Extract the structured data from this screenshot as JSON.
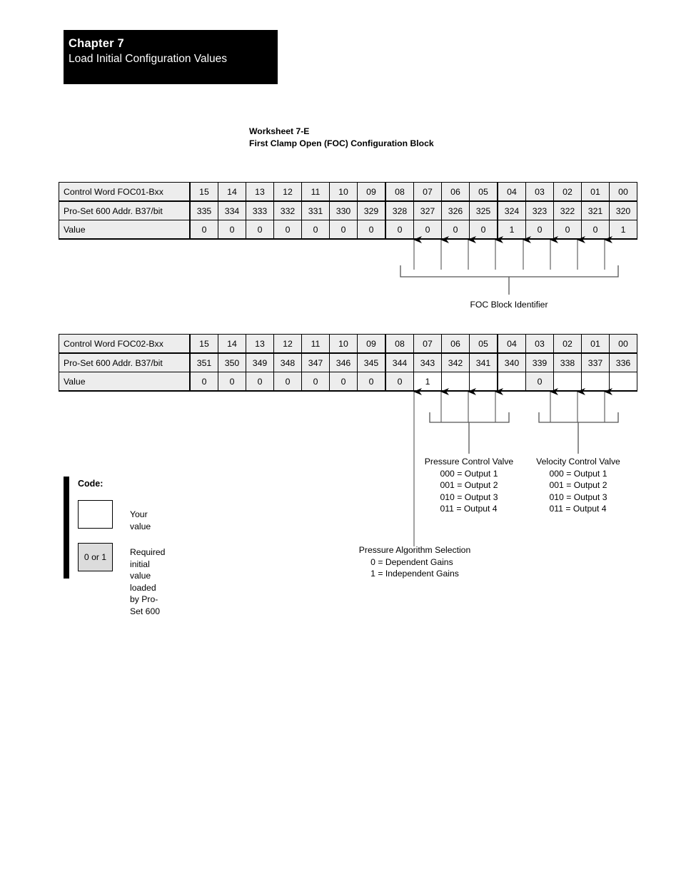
{
  "chapter": {
    "label": "Chapter  7",
    "title": "Load Initial Configuration Values"
  },
  "worksheet": {
    "number": "Worksheet 7-E",
    "name": "First Clamp Open (FOC) Configuration  Block"
  },
  "tables": [
    {
      "id": "foc01",
      "row_labels": {
        "control_word": "Control Word FOC01-Bxx",
        "address": "Pro-Set 600 Addr. B37/bit",
        "value": "Value"
      },
      "bits": [
        "15",
        "14",
        "13",
        "12",
        "11",
        "10",
        "09",
        "08",
        "07",
        "06",
        "05",
        "04",
        "03",
        "02",
        "01",
        "00"
      ],
      "addresses": [
        "335",
        "334",
        "333",
        "332",
        "331",
        "330",
        "329",
        "328",
        "327",
        "326",
        "325",
        "324",
        "323",
        "322",
        "321",
        "320"
      ],
      "values": [
        "0",
        "0",
        "0",
        "0",
        "0",
        "0",
        "0",
        "0",
        "0",
        "0",
        "0",
        "1",
        "0",
        "0",
        "0",
        "1"
      ]
    },
    {
      "id": "foc02",
      "row_labels": {
        "control_word": "Control Word FOC02-Bxx",
        "address": "Pro-Set 600 Addr. B37/bit",
        "value": "Value"
      },
      "bits": [
        "15",
        "14",
        "13",
        "12",
        "11",
        "10",
        "09",
        "08",
        "07",
        "06",
        "05",
        "04",
        "03",
        "02",
        "01",
        "00"
      ],
      "addresses": [
        "351",
        "350",
        "349",
        "348",
        "347",
        "346",
        "345",
        "344",
        "343",
        "342",
        "341",
        "340",
        "339",
        "338",
        "337",
        "336"
      ],
      "values": [
        "0",
        "0",
        "0",
        "0",
        "0",
        "0",
        "0",
        "0",
        "1",
        "",
        "",
        "",
        "0",
        "",
        "",
        ""
      ]
    }
  ],
  "callouts": {
    "foc_block_identifier": "FOC Block Identifier",
    "pressure_control_valve": {
      "title": "Pressure Control Valve",
      "options": [
        "000 = Output 1",
        "001 = Output 2",
        "010 = Output 3",
        "011 = Output 4"
      ]
    },
    "velocity_control_valve": {
      "title": "Velocity Control Valve",
      "options": [
        "000 = Output 1",
        "001 = Output 2",
        "010 = Output 3",
        "011 = Output 4"
      ]
    },
    "pressure_algorithm_selection": {
      "title": "Pressure Algorithm Selection",
      "options": [
        "0 = Dependent Gains",
        "1 = Independent Gains"
      ]
    }
  },
  "code_legend": {
    "title": "Code:",
    "your_value_box": "",
    "your_value_label": "Your value",
    "required_box": "0 or 1",
    "required_label_line1": "Required initial value",
    "required_label_line2": "loaded by Pro-Set 600"
  },
  "colors": {
    "shaded_cell": "#ededed",
    "legend_filled": "#dcdcdc",
    "ink": "#000000",
    "rule_gray": "#7a7a7a"
  }
}
